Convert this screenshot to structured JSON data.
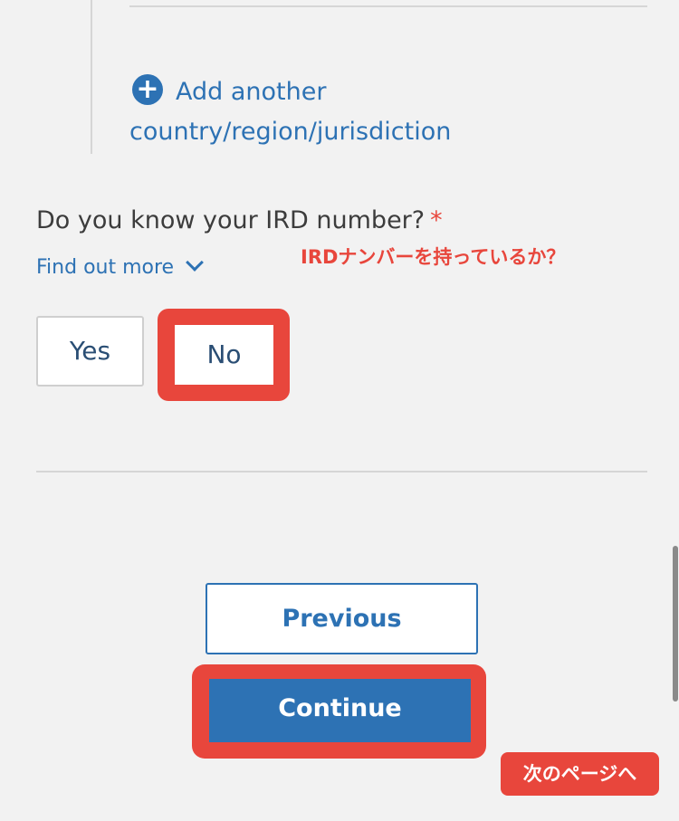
{
  "add_link": {
    "icon": "plus-circle-icon",
    "line1": "Add another",
    "line2": "country/region/jurisdiction"
  },
  "question": {
    "text": "Do you know your IRD number?",
    "required_mark": "*"
  },
  "find_out_more": {
    "label": "Find out more",
    "icon": "chevron-down-icon"
  },
  "annotation": {
    "question_note": "IRDナンバーを持っているか？",
    "next_note": "次のページへ"
  },
  "options": {
    "yes": "Yes",
    "no": "No"
  },
  "nav": {
    "previous": "Previous",
    "continue": "Continue"
  },
  "colors": {
    "link_blue": "#2d72b4",
    "annotation_red": "#e8463c",
    "background": "#f2f2f2"
  }
}
